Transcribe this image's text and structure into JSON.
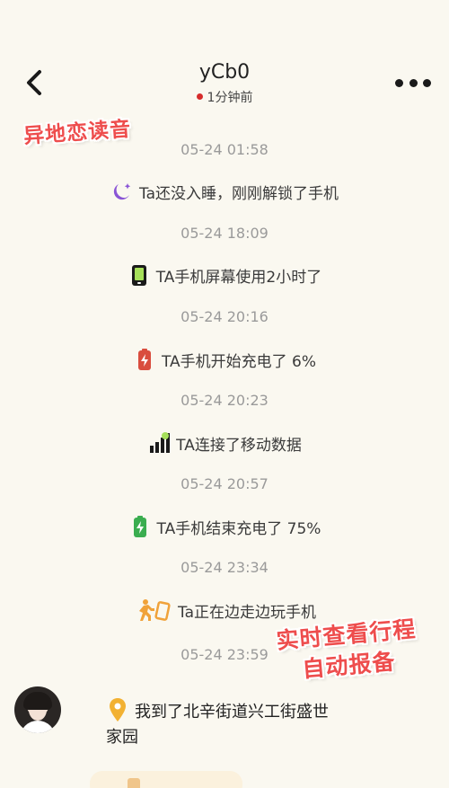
{
  "header": {
    "title": "yCb0",
    "status": "1分钟前",
    "status_color": "#d62b2b"
  },
  "stickers": {
    "top": "异地恋读音",
    "bottom_line1": "实时查看行程",
    "bottom_line2": "自动报备"
  },
  "timeline": [
    {
      "time": "05-24 01:58",
      "icon": "moon-icon",
      "text": "Ta还没入睡，刚刚解锁了手机"
    },
    {
      "time": "05-24 18:09",
      "icon": "phone-screen-icon",
      "text": "TA手机屏幕使用2小时了"
    },
    {
      "time": "05-24 20:16",
      "icon": "battery-charging-red-icon",
      "text": "TA手机开始充电了 6%"
    },
    {
      "time": "05-24 20:23",
      "icon": "signal-bars-icon",
      "text": "TA连接了移动数据"
    },
    {
      "time": "05-24 20:57",
      "icon": "battery-charging-green-icon",
      "text": "TA手机结束充电了 75%"
    },
    {
      "time": "05-24 23:34",
      "icon": "walking-phone-icon",
      "text": "Ta正在边走边玩手机"
    },
    {
      "time": "05-24 23:59"
    }
  ],
  "message": {
    "icon": "location-pin-icon",
    "line1": "我到了北辛街道兴工街盛世",
    "line2": "家园"
  },
  "colors": {
    "background": "#faf8f0",
    "accent_red": "#ee4d4d",
    "timestamp": "#9a9a9a"
  }
}
